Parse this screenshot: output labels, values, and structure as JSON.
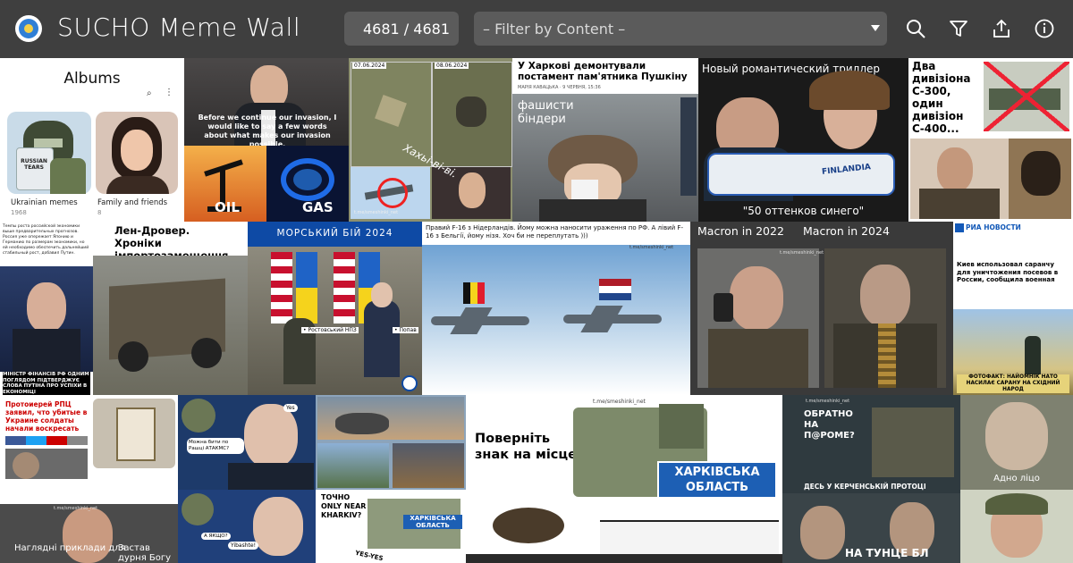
{
  "header": {
    "title": "SUCHO Meme Wall",
    "count": "4681 / 4681",
    "filter_placeholder": "– Filter by Content –",
    "icons": [
      "search-icon",
      "filter-icon",
      "share-icon",
      "info-icon"
    ]
  },
  "tiles": {
    "albums": {
      "title": "Albums",
      "album1_name": "Ukrainian memes",
      "album1_count": "1968",
      "album2_name": "Family and friends",
      "album2_count": "8",
      "sticker_text": "RUSSIAN TEARS"
    },
    "putin": {
      "caption": "Before we continue our invasion, I would like to say a few words about what makes our invasion possible.",
      "oil": "OIL",
      "gas": "GAS"
    },
    "sat": {
      "date1": "07.06.2024",
      "date2": "08.06.2024",
      "watermark": "Хахьі-ві-ві.",
      "channel": "t.me/smeshinki_net"
    },
    "pushkin": {
      "headline": "У Харкові демонтували постамент пам'ятника Пушкіну",
      "byline": "МАРІЯ КАВАЦЬКА · 9 ЧЕРВНЯ, 15:36",
      "overlay": "фашисти бiндери"
    },
    "thriller": {
      "headline": "Новый романтический триллер",
      "bottle": "FINLANDIA",
      "caption": "\"50 оттенков синего\""
    },
    "s300": {
      "text": "Два дивізіона С-300, один дивізіон С-400..."
    },
    "minister": {
      "top": "Темпы роста российской экономики выше предварительных прогнозов. Россия уже опережает Японию и Германию по размерам экономики, но ей необходимо обеспечить дальнейший стабильный рост, добавил Путин.",
      "bottom": "МІНІСТР ФІНАНСІВ РФ ОДНИМ ПОГЛЯДОМ ПІДТВЕРДЖУЄ СЛОВА ПУТІНА ПРО УСПІХИ В ЕКОНОМІЦІ"
    },
    "landrover": {
      "headline": "Лен-Дровер. Хроніки імпортозамещення"
    },
    "seabattle": {
      "headline": "МОРСЬКИЙ БІЙ 2024",
      "tag1": "• Ростовський НПЗ",
      "tag2": "• Попав",
      "channel": "t.me/smeshinki_net"
    },
    "f16": {
      "text": "Правий F-16 з Нідерландів. Йому можна наносити ураження по РФ. А лівий F-16 з Бельгії, йому нізя. Хоч би не переплутать )))",
      "channel": "t.me/smeshinki_net"
    },
    "macron": {
      "left": "Macron in 2022",
      "right": "Macron in 2024",
      "channel": "t.me/smeshinki_net"
    },
    "ria": {
      "brand": "РИА НОВОСТИ",
      "headline": "Киев использовал саранчу для уничтожения посевов в России, сообщила военная",
      "photo_caption": "ФОТОФАКТ: НАЙОМНІК НАТО НАСИЛАЄ САРАНУ НА СХІДНИЙ НАРОД"
    },
    "rpc": {
      "headline": "Протоиерей РПЦ заявил, что убитые в Украине солдаты начали воскресать",
      "caption_left": "Наглядні приклади для",
      "caption_right": "Застав дурня Богу",
      "channel": "t.me/smeshinki_net"
    },
    "biden1": {
      "bubble1": "Можна бити по Рашці АТАКМС?",
      "bubble2": "Yes"
    },
    "biden2": {
      "bubble1": "A ЯКЩО?",
      "bubble2": "Yibashte!"
    },
    "kharkiv_small": {
      "text1": "ТОЧНО ONLY NEAR KHARKIV?",
      "sign": "ХАРКІВСЬКА ОБЛАСТЬ",
      "yes": "YES-YES"
    },
    "kharkiv_big": {
      "channel": "t.me/smeshinki_net",
      "text": "Поверніть знак на місце",
      "sign": "ХАРКІВСЬКА ОБЛАСТЬ"
    },
    "kerch": {
      "top": "ОБРАТНО НА П@РОМЕ?",
      "mid": "ДЕСЬ У КЕРЧЕНСЬКІЙ ПРОТОЦІ",
      "bottom": "НА ТУНЦЕ БЛ",
      "channel": "t.me/smeshinki_net"
    },
    "adno": {
      "caption": "Адно ліцо"
    }
  }
}
